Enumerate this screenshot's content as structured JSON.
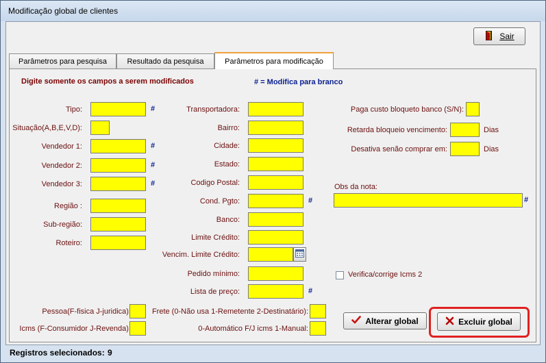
{
  "window": {
    "title": "Modificação global de clientes"
  },
  "toolbar": {
    "exit_label": "Sair"
  },
  "tabs": [
    {
      "label": "Parâmetros para pesquisa"
    },
    {
      "label": "Resultado da pesquisa"
    },
    {
      "label": "Parâmetros para modificação"
    }
  ],
  "form": {
    "instruction": "Digite somente os campos a serem modificados",
    "hash_legend": "# = Modifica para branco",
    "hash": "#",
    "left": {
      "tipo": "Tipo:",
      "situacao": "Situação(A,B,E,V,D):",
      "vendedor1": "Vendedor 1:",
      "vendedor2": "Vendedor 2:",
      "vendedor3": "Vendedor 3:",
      "regiao": "Região :",
      "subregiao": "Sub-região:",
      "roteiro": "Roteiro:",
      "pessoa": "Pessoa(F-fisica J-juridica):",
      "icms": "Icms (F-Consumidor J-Revenda):"
    },
    "middle": {
      "transportadora": "Transportadora:",
      "bairro": "Bairro:",
      "cidade": "Cidade:",
      "estado": "Estado:",
      "codigo_postal": "Codigo Postal:",
      "cond_pgto": "Cond. Pgto:",
      "banco": "Banco:",
      "limite_credito": "Limite Crédito:",
      "vencim_limite": "Vencim. Limite Crédito:",
      "pedido_minimo": "Pedido mínimo:",
      "lista_preco": "Lista de preço:",
      "frete": "Frete (0-Não usa 1-Remetente 2-Destinatário):",
      "automatico": "0-Automático F/J icms 1-Manual:"
    },
    "right": {
      "paga_custo": "Paga custo bloqueto banco (S/N):",
      "retarda": "Retarda bloqueio vencimento:",
      "desativa": "Desativa senão comprar em:",
      "dias": "Dias",
      "obs_nota": "Obs da nota:",
      "verifica_icms": "Verifica/corrige Icms 2"
    }
  },
  "actions": {
    "alterar_label": "Alterar global",
    "excluir_label": "Excluir global"
  },
  "status": {
    "registros_label": "Registros selecionados:",
    "registros_value": "9"
  },
  "colors": {
    "field_bg": "#ffff00",
    "label": "#6b0f0f",
    "hash": "#0a1f8f",
    "highlight": "#e02020",
    "tab_active_accent": "#f0a23b"
  }
}
